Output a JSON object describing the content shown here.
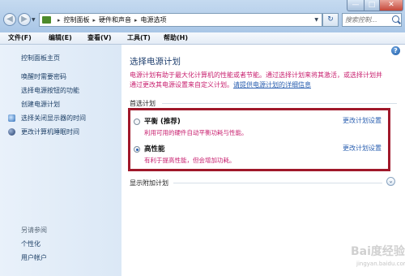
{
  "window": {
    "controls": {
      "minimize": "—",
      "maximize": "□",
      "close": "✕"
    },
    "breadcrumbs": [
      "控制面板",
      "硬件和声音",
      "电源选项"
    ],
    "refresh_icon": "refresh-icon",
    "search": {
      "placeholder": "搜索控制..."
    }
  },
  "menu": [
    "文件(F)",
    "编辑(E)",
    "查看(V)",
    "工具(T)",
    "帮助(H)"
  ],
  "sidebar": {
    "home": "控制面板主页",
    "items": [
      {
        "label": "唤醒时需要密码",
        "icon": ""
      },
      {
        "label": "选择电源按钮的功能",
        "icon": ""
      },
      {
        "label": "创建电源计划",
        "icon": ""
      },
      {
        "label": "选择关闭显示器的时间",
        "icon": "monitor-icon"
      },
      {
        "label": "更改计算机睡眠时间",
        "icon": "moon-icon"
      }
    ],
    "see_also": {
      "label": "另请参阅",
      "items": [
        "个性化",
        "用户帐户"
      ]
    }
  },
  "main": {
    "title": "选择电源计划",
    "description_line1": "电源计划有助于最大化计算机的性能或者节能。通过选择计划来将其激活，或选择计划并",
    "description_line2_pre": "通过更改其电源设置来自定义计划。",
    "description_link": "请提供电源计划的详细信息",
    "preferred_label": "首选计划",
    "plans": [
      {
        "name": "平衡 (推荐)",
        "description": "利用可用的硬件自动平衡功耗与性能。",
        "link": "更改计划设置",
        "selected": false
      },
      {
        "name": "高性能",
        "description": "有利于提高性能，但会增加功耗。",
        "link": "更改计划设置",
        "selected": true
      }
    ],
    "more_plans_label": "显示附加计划",
    "expand_icon": "chevron-down-icon"
  },
  "watermark": {
    "text": "Bai度经验",
    "url": "jingyan.baidu.com"
  },
  "colors": {
    "accent_pink": "#c8206f",
    "link_blue": "#2a5fb0",
    "highlight_box": "#a0182a"
  }
}
